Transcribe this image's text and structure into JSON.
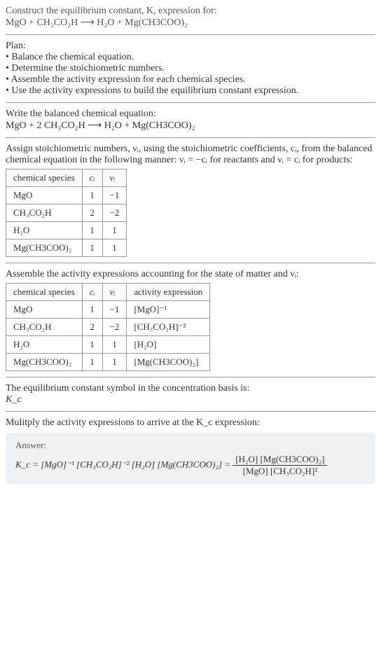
{
  "question": {
    "lead": "Construct the equilibrium constant, K, expression for:",
    "equation": "MgO + CH₃CO₂H ⟶ H₂O + Mg(CH3COO)₂"
  },
  "plan": {
    "heading": "Plan:",
    "items": [
      "Balance the chemical equation.",
      "Determine the stoichiometric numbers.",
      "Assemble the activity expression for each chemical species.",
      "Use the activity expressions to build the equilibrium constant expression."
    ]
  },
  "balanced": {
    "heading": "Write the balanced chemical equation:",
    "equation": "MgO + 2 CH₃CO₂H ⟶ H₂O + Mg(CH3COO)₂"
  },
  "stoich": {
    "heading": "Assign stoichiometric numbers, νᵢ, using the stoichiometric coefficients, cᵢ, from the balanced chemical equation in the following manner: νᵢ = −cᵢ for reactants and νᵢ = cᵢ for products:",
    "table": {
      "headers": {
        "species": "chemical species",
        "ci": "cᵢ",
        "vi": "νᵢ"
      },
      "rows": [
        {
          "species": "MgO",
          "ci": "1",
          "vi": "−1"
        },
        {
          "species": "CH₃CO₂H",
          "ci": "2",
          "vi": "−2"
        },
        {
          "species": "H₂O",
          "ci": "1",
          "vi": "1"
        },
        {
          "species": "Mg(CH3COO)₂",
          "ci": "1",
          "vi": "1"
        }
      ]
    }
  },
  "activity": {
    "heading": "Assemble the activity expressions accounting for the state of matter and νᵢ:",
    "table": {
      "headers": {
        "species": "chemical species",
        "ci": "cᵢ",
        "vi": "νᵢ",
        "expr": "activity expression"
      },
      "rows": [
        {
          "species": "MgO",
          "ci": "1",
          "vi": "−1",
          "expr": "[MgO]⁻¹"
        },
        {
          "species": "CH₃CO₂H",
          "ci": "2",
          "vi": "−2",
          "expr": "[CH₃CO₂H]⁻²"
        },
        {
          "species": "H₂O",
          "ci": "1",
          "vi": "1",
          "expr": "[H₂O]"
        },
        {
          "species": "Mg(CH3COO)₂",
          "ci": "1",
          "vi": "1",
          "expr": "[Mg(CH3COO)₂]"
        }
      ]
    }
  },
  "basis": {
    "heading": "The equilibrium constant symbol in the concentration basis is:",
    "symbol": "K_c"
  },
  "multiply": {
    "heading": "Mulitply the activity expressions to arrive at the K_c expression:"
  },
  "answer": {
    "label": "Answer:",
    "lhs": "K_c = [MgO]⁻¹ [CH₃CO₂H]⁻² [H₂O] [Mg(CH3COO)₂] =",
    "frac_num": "[H₂O] [Mg(CH3COO)₂]",
    "frac_den": "[MgO] [CH₃CO₂H]²"
  },
  "chart_data": {
    "type": "table",
    "tables": [
      {
        "title": "Stoichiometric numbers",
        "columns": [
          "chemical species",
          "cᵢ",
          "νᵢ"
        ],
        "rows": [
          [
            "MgO",
            1,
            -1
          ],
          [
            "CH₃CO₂H",
            2,
            -2
          ],
          [
            "H₂O",
            1,
            1
          ],
          [
            "Mg(CH3COO)₂",
            1,
            1
          ]
        ]
      },
      {
        "title": "Activity expressions",
        "columns": [
          "chemical species",
          "cᵢ",
          "νᵢ",
          "activity expression"
        ],
        "rows": [
          [
            "MgO",
            1,
            -1,
            "[MgO]⁻¹"
          ],
          [
            "CH₃CO₂H",
            2,
            -2,
            "[CH₃CO₂H]⁻²"
          ],
          [
            "H₂O",
            1,
            1,
            "[H₂O]"
          ],
          [
            "Mg(CH3COO)₂",
            1,
            1,
            "[Mg(CH3COO)₂]"
          ]
        ]
      }
    ]
  }
}
